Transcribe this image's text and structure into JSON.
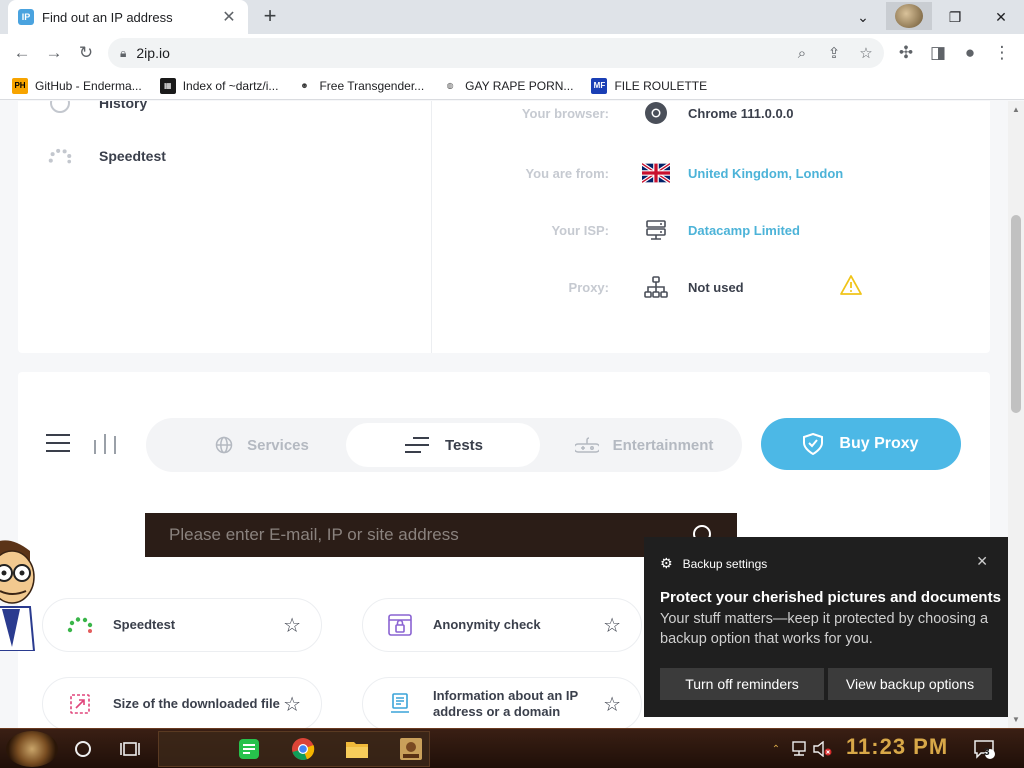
{
  "browser": {
    "tab_title": "Find out an IP address",
    "tab_favicon": "IP",
    "url": "2ip.io",
    "accent": "#4aa3df"
  },
  "bookmarks": [
    {
      "label": "GitHub - Enderma...",
      "icon": "PH",
      "color": "#f7a400",
      "fg": "#000"
    },
    {
      "label": "Index of ~dartz/i...",
      "icon": "grid-icon",
      "color": "#1a1a1a",
      "fg": "#fff"
    },
    {
      "label": "Free Transgender...",
      "icon": "mask-icon",
      "color": "#ffffff",
      "fg": "#333"
    },
    {
      "label": "GAY RAPE PORN...",
      "icon": "globe-icon",
      "color": "#ffffff",
      "fg": "#555"
    },
    {
      "label": "FILE ROULETTE",
      "icon": "MF",
      "color": "#1a3fb5",
      "fg": "#fff"
    }
  ],
  "sidebar": {
    "items": [
      {
        "label": "History",
        "icon": "history-icon"
      },
      {
        "label": "Speedtest",
        "icon": "speedometer-icon"
      }
    ]
  },
  "info": {
    "browser": {
      "label": "Your browser:",
      "value": "Chrome 111.0.0.0"
    },
    "location": {
      "label": "You are from:",
      "value": "United Kingdom, London"
    },
    "isp": {
      "label": "Your ISP:",
      "value": "Datacamp Limited"
    },
    "proxy": {
      "label": "Proxy:",
      "value": "Not used"
    }
  },
  "nav": {
    "services": "Services",
    "tests": "Tests",
    "entertainment": "Entertainment",
    "buy_proxy": "Buy Proxy"
  },
  "search": {
    "placeholder": "Please enter E-mail, IP or site address"
  },
  "tests": [
    {
      "label": "Speedtest",
      "icon": "speedometer-icon"
    },
    {
      "label": "Anonymity check",
      "icon": "lock-browser-icon"
    },
    {
      "label": "Size of the downloaded file",
      "icon": "file-size-icon"
    },
    {
      "label": "Information about an IP address or a domain",
      "icon": "server-info-icon"
    }
  ],
  "toast": {
    "app": "Backup settings",
    "heading": "Protect your cherished pictures and documents",
    "body": "Your stuff matters—keep it protected by choosing a backup option that works for you.",
    "btn_off": "Turn off reminders",
    "btn_view": "View backup options"
  },
  "taskbar": {
    "clock": "11:23 PM",
    "notification_count": "3"
  },
  "colors": {
    "brand_blue": "#4cb8e6",
    "link": "#4cb3d8",
    "warning": "#f0c419"
  }
}
